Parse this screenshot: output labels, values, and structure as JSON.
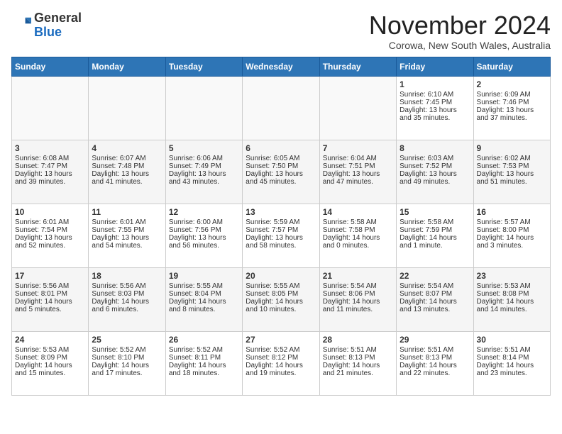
{
  "header": {
    "logo_general": "General",
    "logo_blue": "Blue",
    "month_title": "November 2024",
    "location": "Corowa, New South Wales, Australia"
  },
  "days_of_week": [
    "Sunday",
    "Monday",
    "Tuesday",
    "Wednesday",
    "Thursday",
    "Friday",
    "Saturday"
  ],
  "weeks": [
    [
      {
        "day": "",
        "sunrise": "",
        "sunset": "",
        "daylight": ""
      },
      {
        "day": "",
        "sunrise": "",
        "sunset": "",
        "daylight": ""
      },
      {
        "day": "",
        "sunrise": "",
        "sunset": "",
        "daylight": ""
      },
      {
        "day": "",
        "sunrise": "",
        "sunset": "",
        "daylight": ""
      },
      {
        "day": "",
        "sunrise": "",
        "sunset": "",
        "daylight": ""
      },
      {
        "day": "1",
        "sunrise": "Sunrise: 6:10 AM",
        "sunset": "Sunset: 7:45 PM",
        "daylight": "Daylight: 13 hours and 35 minutes."
      },
      {
        "day": "2",
        "sunrise": "Sunrise: 6:09 AM",
        "sunset": "Sunset: 7:46 PM",
        "daylight": "Daylight: 13 hours and 37 minutes."
      }
    ],
    [
      {
        "day": "3",
        "sunrise": "Sunrise: 6:08 AM",
        "sunset": "Sunset: 7:47 PM",
        "daylight": "Daylight: 13 hours and 39 minutes."
      },
      {
        "day": "4",
        "sunrise": "Sunrise: 6:07 AM",
        "sunset": "Sunset: 7:48 PM",
        "daylight": "Daylight: 13 hours and 41 minutes."
      },
      {
        "day": "5",
        "sunrise": "Sunrise: 6:06 AM",
        "sunset": "Sunset: 7:49 PM",
        "daylight": "Daylight: 13 hours and 43 minutes."
      },
      {
        "day": "6",
        "sunrise": "Sunrise: 6:05 AM",
        "sunset": "Sunset: 7:50 PM",
        "daylight": "Daylight: 13 hours and 45 minutes."
      },
      {
        "day": "7",
        "sunrise": "Sunrise: 6:04 AM",
        "sunset": "Sunset: 7:51 PM",
        "daylight": "Daylight: 13 hours and 47 minutes."
      },
      {
        "day": "8",
        "sunrise": "Sunrise: 6:03 AM",
        "sunset": "Sunset: 7:52 PM",
        "daylight": "Daylight: 13 hours and 49 minutes."
      },
      {
        "day": "9",
        "sunrise": "Sunrise: 6:02 AM",
        "sunset": "Sunset: 7:53 PM",
        "daylight": "Daylight: 13 hours and 51 minutes."
      }
    ],
    [
      {
        "day": "10",
        "sunrise": "Sunrise: 6:01 AM",
        "sunset": "Sunset: 7:54 PM",
        "daylight": "Daylight: 13 hours and 52 minutes."
      },
      {
        "day": "11",
        "sunrise": "Sunrise: 6:01 AM",
        "sunset": "Sunset: 7:55 PM",
        "daylight": "Daylight: 13 hours and 54 minutes."
      },
      {
        "day": "12",
        "sunrise": "Sunrise: 6:00 AM",
        "sunset": "Sunset: 7:56 PM",
        "daylight": "Daylight: 13 hours and 56 minutes."
      },
      {
        "day": "13",
        "sunrise": "Sunrise: 5:59 AM",
        "sunset": "Sunset: 7:57 PM",
        "daylight": "Daylight: 13 hours and 58 minutes."
      },
      {
        "day": "14",
        "sunrise": "Sunrise: 5:58 AM",
        "sunset": "Sunset: 7:58 PM",
        "daylight": "Daylight: 14 hours and 0 minutes."
      },
      {
        "day": "15",
        "sunrise": "Sunrise: 5:58 AM",
        "sunset": "Sunset: 7:59 PM",
        "daylight": "Daylight: 14 hours and 1 minute."
      },
      {
        "day": "16",
        "sunrise": "Sunrise: 5:57 AM",
        "sunset": "Sunset: 8:00 PM",
        "daylight": "Daylight: 14 hours and 3 minutes."
      }
    ],
    [
      {
        "day": "17",
        "sunrise": "Sunrise: 5:56 AM",
        "sunset": "Sunset: 8:01 PM",
        "daylight": "Daylight: 14 hours and 5 minutes."
      },
      {
        "day": "18",
        "sunrise": "Sunrise: 5:56 AM",
        "sunset": "Sunset: 8:03 PM",
        "daylight": "Daylight: 14 hours and 6 minutes."
      },
      {
        "day": "19",
        "sunrise": "Sunrise: 5:55 AM",
        "sunset": "Sunset: 8:04 PM",
        "daylight": "Daylight: 14 hours and 8 minutes."
      },
      {
        "day": "20",
        "sunrise": "Sunrise: 5:55 AM",
        "sunset": "Sunset: 8:05 PM",
        "daylight": "Daylight: 14 hours and 10 minutes."
      },
      {
        "day": "21",
        "sunrise": "Sunrise: 5:54 AM",
        "sunset": "Sunset: 8:06 PM",
        "daylight": "Daylight: 14 hours and 11 minutes."
      },
      {
        "day": "22",
        "sunrise": "Sunrise: 5:54 AM",
        "sunset": "Sunset: 8:07 PM",
        "daylight": "Daylight: 14 hours and 13 minutes."
      },
      {
        "day": "23",
        "sunrise": "Sunrise: 5:53 AM",
        "sunset": "Sunset: 8:08 PM",
        "daylight": "Daylight: 14 hours and 14 minutes."
      }
    ],
    [
      {
        "day": "24",
        "sunrise": "Sunrise: 5:53 AM",
        "sunset": "Sunset: 8:09 PM",
        "daylight": "Daylight: 14 hours and 15 minutes."
      },
      {
        "day": "25",
        "sunrise": "Sunrise: 5:52 AM",
        "sunset": "Sunset: 8:10 PM",
        "daylight": "Daylight: 14 hours and 17 minutes."
      },
      {
        "day": "26",
        "sunrise": "Sunrise: 5:52 AM",
        "sunset": "Sunset: 8:11 PM",
        "daylight": "Daylight: 14 hours and 18 minutes."
      },
      {
        "day": "27",
        "sunrise": "Sunrise: 5:52 AM",
        "sunset": "Sunset: 8:12 PM",
        "daylight": "Daylight: 14 hours and 19 minutes."
      },
      {
        "day": "28",
        "sunrise": "Sunrise: 5:51 AM",
        "sunset": "Sunset: 8:13 PM",
        "daylight": "Daylight: 14 hours and 21 minutes."
      },
      {
        "day": "29",
        "sunrise": "Sunrise: 5:51 AM",
        "sunset": "Sunset: 8:13 PM",
        "daylight": "Daylight: 14 hours and 22 minutes."
      },
      {
        "day": "30",
        "sunrise": "Sunrise: 5:51 AM",
        "sunset": "Sunset: 8:14 PM",
        "daylight": "Daylight: 14 hours and 23 minutes."
      }
    ]
  ]
}
